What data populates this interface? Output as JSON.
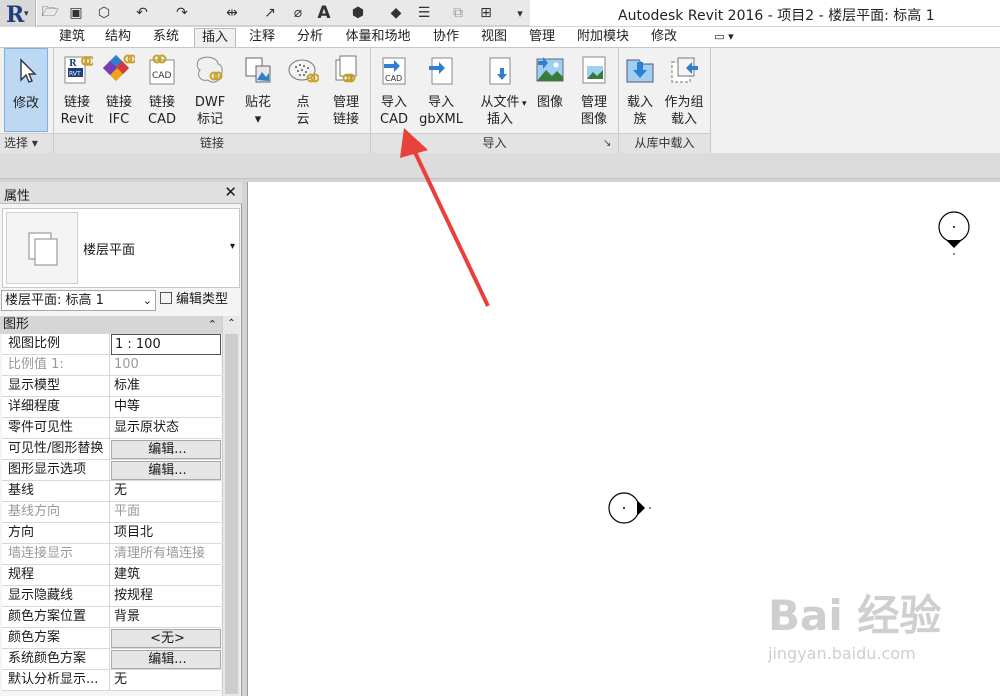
{
  "app": {
    "title": "Autodesk Revit 2016 -    项目2 - 楼层平面: 标高 1",
    "logo_letter": "R",
    "logo_caret": "▾"
  },
  "quick_access": [
    {
      "icon": "open-folder-icon",
      "glyph": "🗁"
    },
    {
      "icon": "save-icon",
      "glyph": "▣"
    },
    {
      "icon": "sync-icon",
      "glyph": "⬡"
    },
    {
      "icon": "undo-icon",
      "glyph": "↶"
    },
    {
      "icon": "redo-icon",
      "glyph": "↷"
    },
    {
      "icon": "measure-icon",
      "glyph": "⇹"
    },
    {
      "icon": "dimension-icon",
      "glyph": "↗"
    },
    {
      "icon": "tag-icon",
      "glyph": "⌀"
    },
    {
      "icon": "text-icon",
      "glyph": "A"
    },
    {
      "icon": "3d-view-icon",
      "glyph": "⬢"
    },
    {
      "icon": "section-icon",
      "glyph": "◆"
    },
    {
      "icon": "thin-lines-icon",
      "glyph": "☰"
    },
    {
      "icon": "close-hidden-icon",
      "glyph": "⧉"
    },
    {
      "icon": "switch-windows-icon",
      "glyph": "⊞"
    },
    {
      "icon": "qat-customize-icon",
      "glyph": "▾"
    }
  ],
  "tabs": [
    {
      "label": "建筑"
    },
    {
      "label": "结构"
    },
    {
      "label": "系统"
    },
    {
      "label": "插入"
    },
    {
      "label": "注释"
    },
    {
      "label": "分析"
    },
    {
      "label": "体量和场地"
    },
    {
      "label": "协作"
    },
    {
      "label": "视图"
    },
    {
      "label": "管理"
    },
    {
      "label": "附加模块"
    },
    {
      "label": "修改"
    },
    {
      "label": "▭ ▾"
    }
  ],
  "active_tab": "插入",
  "ribbon": {
    "buttons": [
      {
        "label": "修改",
        "icon": "modify-cursor-icon"
      },
      {
        "label": "链接\nRevit",
        "icon": "link-revit-icon"
      },
      {
        "label": "链接\nIFC",
        "icon": "link-ifc-icon"
      },
      {
        "label": "链接\nCAD",
        "icon": "link-cad-icon"
      },
      {
        "label": "DWF\n标记",
        "icon": "dwf-markup-icon"
      },
      {
        "label": "贴花\n▾",
        "icon": "decal-icon"
      },
      {
        "label": "点\n云",
        "icon": "point-cloud-icon"
      },
      {
        "label": "管理\n链接",
        "icon": "manage-links-icon"
      },
      {
        "label": "导入\nCAD",
        "icon": "import-cad-icon"
      },
      {
        "label": "导入\ngbXML",
        "icon": "import-gbxml-icon"
      },
      {
        "label": "从文件\n插入",
        "icon": "insert-from-file-icon"
      },
      {
        "label": "图像",
        "icon": "image-icon"
      },
      {
        "label": "管理\n图像",
        "icon": "manage-images-icon"
      },
      {
        "label": "载入\n族",
        "icon": "load-family-icon"
      },
      {
        "label": "作为组\n载入",
        "icon": "load-as-group-icon"
      }
    ],
    "panels": [
      {
        "label": "选择 ▾"
      },
      {
        "label": "链接"
      },
      {
        "label": "导入"
      },
      {
        "label": "从库中载入"
      }
    ],
    "import_launcher": "↘",
    "insert_from_file_caret": "▾",
    "link_cad_badge": "CAD",
    "import_cad_badge": "CAD",
    "link_revit_badge": "RVT"
  },
  "properties": {
    "title": "属性",
    "close": "✕",
    "type_name": "楼层平面",
    "type_caret": "▾",
    "instance_selector": "楼层平面: 标高 1",
    "instance_caret": "⌄",
    "edit_type_label": "编辑类型",
    "category": "图形",
    "category_collapse": "⌃",
    "scroll_up": "⌃",
    "rows": [
      {
        "key": "视图比例",
        "value": "1 : 100"
      },
      {
        "key": "比例值 1:",
        "value": "100"
      },
      {
        "key": "显示模型",
        "value": "标准"
      },
      {
        "key": "详细程度",
        "value": "中等"
      },
      {
        "key": "零件可见性",
        "value": "显示原状态"
      },
      {
        "key": "可见性/图形替换",
        "value": "编辑..."
      },
      {
        "key": "图形显示选项",
        "value": "编辑..."
      },
      {
        "key": "基线",
        "value": "无"
      },
      {
        "key": "基线方向",
        "value": "平面"
      },
      {
        "key": "方向",
        "value": "项目北"
      },
      {
        "key": "墙连接显示",
        "value": "清理所有墙连接"
      },
      {
        "key": "规程",
        "value": "建筑"
      },
      {
        "key": "显示隐藏线",
        "value": "按规程"
      },
      {
        "key": "颜色方案位置",
        "value": "背景"
      },
      {
        "key": "颜色方案",
        "value": "<无>"
      },
      {
        "key": "系统颜色方案",
        "value": "编辑..."
      },
      {
        "key": "默认分析显示...",
        "value": "无"
      }
    ]
  },
  "watermark": {
    "brand": "Bai 经验",
    "url": "jingyan.baidu.com"
  },
  "colors": {
    "annotation_arrow": "#e8403a",
    "modify_active": "#bcd8f2",
    "icon_blue": "#2f7fd0"
  }
}
